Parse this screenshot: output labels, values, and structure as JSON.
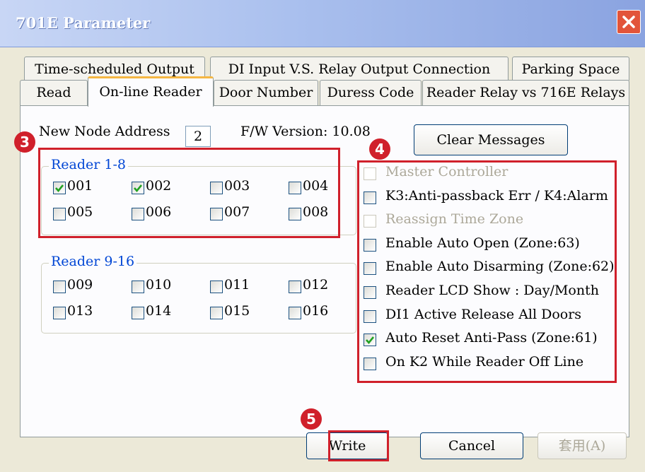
{
  "window": {
    "title": "701E Parameter"
  },
  "tabs": {
    "row1": [
      {
        "label": "Time-scheduled Output"
      },
      {
        "label": "DI Input  V.S. Relay Output Connection"
      },
      {
        "label": "Parking Space"
      }
    ],
    "row2": [
      {
        "label": "Read"
      },
      {
        "label": "On-line Reader",
        "active": true
      },
      {
        "label": "Door Number"
      },
      {
        "label": "Duress Code"
      },
      {
        "label": "Reader Relay vs 716E Relays"
      }
    ]
  },
  "node": {
    "label": "New Node Address",
    "value": "2"
  },
  "firmware": {
    "text": "F/W Version: 10.08"
  },
  "clear_button": {
    "label": "Clear Messages"
  },
  "readers_1_8": {
    "title": "Reader 1-8",
    "items": [
      {
        "label": "001",
        "checked": true
      },
      {
        "label": "002",
        "checked": true
      },
      {
        "label": "003",
        "checked": false
      },
      {
        "label": "004",
        "checked": false
      },
      {
        "label": "005",
        "checked": false
      },
      {
        "label": "006",
        "checked": false
      },
      {
        "label": "007",
        "checked": false
      },
      {
        "label": "008",
        "checked": false
      }
    ]
  },
  "readers_9_16": {
    "title": "Reader 9-16",
    "items": [
      {
        "label": "009",
        "checked": false
      },
      {
        "label": "010",
        "checked": false
      },
      {
        "label": "011",
        "checked": false
      },
      {
        "label": "012",
        "checked": false
      },
      {
        "label": "013",
        "checked": false
      },
      {
        "label": "014",
        "checked": false
      },
      {
        "label": "015",
        "checked": false
      },
      {
        "label": "016",
        "checked": false
      }
    ]
  },
  "options": [
    {
      "label": "Master Controller",
      "checked": false,
      "enabled": false
    },
    {
      "label": "K3:Anti-passback Err / K4:Alarm",
      "checked": false,
      "enabled": true
    },
    {
      "label": "Reassign Time Zone",
      "checked": false,
      "enabled": false
    },
    {
      "label": "Enable Auto Open  (Zone:63)",
      "checked": false,
      "enabled": true
    },
    {
      "label": "Enable Auto Disarming (Zone:62)",
      "checked": false,
      "enabled": true
    },
    {
      "label": "Reader LCD Show : Day/Month",
      "checked": false,
      "enabled": true
    },
    {
      "label": "DI1 Active Release All Doors",
      "checked": false,
      "enabled": true
    },
    {
      "label": "Auto Reset Anti-Pass (Zone:61)",
      "checked": true,
      "enabled": true
    },
    {
      "label": "On K2 While Reader Off Line",
      "checked": false,
      "enabled": true
    }
  ],
  "buttons": {
    "write": "Write",
    "cancel": "Cancel",
    "apply": "套用(A)"
  },
  "annotations": {
    "badge3": "3",
    "badge4": "4",
    "badge5": "5",
    "highlight_color": "#d0202b"
  },
  "colors": {
    "accent": "#0046d5",
    "check": "#21a121",
    "window_bg": "#ece9d8"
  },
  "icons": {
    "close": "close-icon",
    "check": "checkmark-icon"
  }
}
